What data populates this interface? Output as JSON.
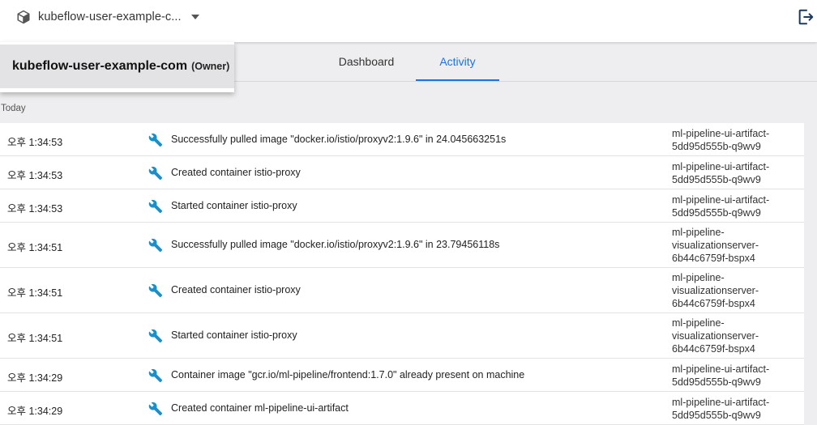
{
  "namespace_selector": {
    "label": "kubeflow-user-example-c...",
    "icon": "cube-icon"
  },
  "header": {
    "logout_icon": "logout-icon"
  },
  "dropdown": {
    "options": [
      {
        "name": "kubeflow-user-example-com",
        "role": "(Owner)"
      }
    ]
  },
  "tabs": [
    {
      "label": "Dashboard",
      "active": false
    },
    {
      "label": "Activity",
      "active": true
    }
  ],
  "accent_color": "#1a73e8",
  "icon_color": "#1a8fc9",
  "section": {
    "label": "Today"
  },
  "events": [
    {
      "time": "오후 1:34:53",
      "message": "Successfully pulled image \"docker.io/istio/proxyv2:1.9.6\" in 24.045663251s",
      "source_lines": [
        "ml-pipeline-ui-artifact-",
        "5dd95d555b-q9wv9"
      ]
    },
    {
      "time": "오후 1:34:53",
      "message": "Created container istio-proxy",
      "source_lines": [
        "ml-pipeline-ui-artifact-",
        "5dd95d555b-q9wv9"
      ]
    },
    {
      "time": "오후 1:34:53",
      "message": "Started container istio-proxy",
      "source_lines": [
        "ml-pipeline-ui-artifact-",
        "5dd95d555b-q9wv9"
      ]
    },
    {
      "time": "오후 1:34:51",
      "message": "Successfully pulled image \"docker.io/istio/proxyv2:1.9.6\" in 23.79456118s",
      "source_lines": [
        "ml-pipeline-",
        "visualizationserver-",
        "6b44c6759f-bspx4"
      ]
    },
    {
      "time": "오후 1:34:51",
      "message": "Created container istio-proxy",
      "source_lines": [
        "ml-pipeline-",
        "visualizationserver-",
        "6b44c6759f-bspx4"
      ]
    },
    {
      "time": "오후 1:34:51",
      "message": "Started container istio-proxy",
      "source_lines": [
        "ml-pipeline-",
        "visualizationserver-",
        "6b44c6759f-bspx4"
      ]
    },
    {
      "time": "오후 1:34:29",
      "message": "Container image \"gcr.io/ml-pipeline/frontend:1.7.0\" already present on machine",
      "source_lines": [
        "ml-pipeline-ui-artifact-",
        "5dd95d555b-q9wv9"
      ]
    },
    {
      "time": "오후 1:34:29",
      "message": "Created container ml-pipeline-ui-artifact",
      "source_lines": [
        "ml-pipeline-ui-artifact-",
        "5dd95d555b-q9wv9"
      ]
    }
  ]
}
